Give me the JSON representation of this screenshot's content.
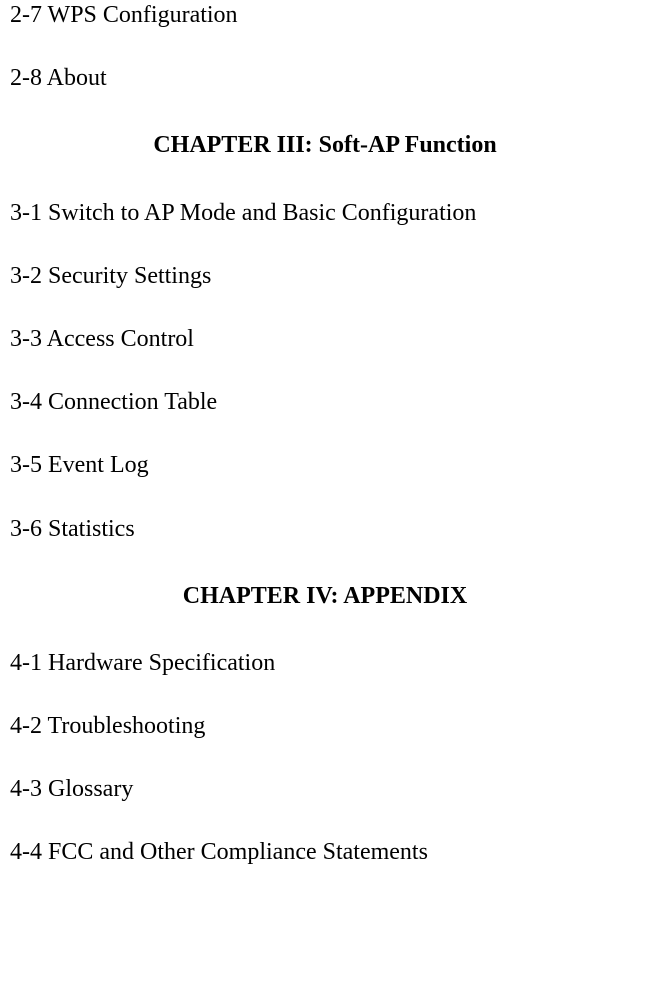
{
  "items": [
    {
      "type": "entry",
      "text": "2-7 WPS Configuration"
    },
    {
      "type": "entry",
      "text": "2-8  About"
    },
    {
      "type": "heading",
      "text": "CHAPTER III:    Soft-AP Function"
    },
    {
      "type": "entry",
      "text": "3-1 Switch to AP Mode and Basic Configuration"
    },
    {
      "type": "entry",
      "text": "3-2 Security Settings"
    },
    {
      "type": "entry",
      "text": "3-3 Access Control"
    },
    {
      "type": "entry",
      "text": "3-4 Connection Table"
    },
    {
      "type": "entry",
      "text": "3-5 Event Log"
    },
    {
      "type": "entry",
      "text": "3-6 Statistics"
    },
    {
      "type": "heading",
      "text": "CHAPTER IV:    APPENDIX"
    },
    {
      "type": "entry",
      "text": "4-1 Hardware Specification"
    },
    {
      "type": "entry",
      "text": "4-2 Troubleshooting"
    },
    {
      "type": "entry",
      "text": "4-3 Glossary"
    },
    {
      "type": "entry",
      "text": "4-4 FCC and Other Compliance Statements"
    }
  ]
}
